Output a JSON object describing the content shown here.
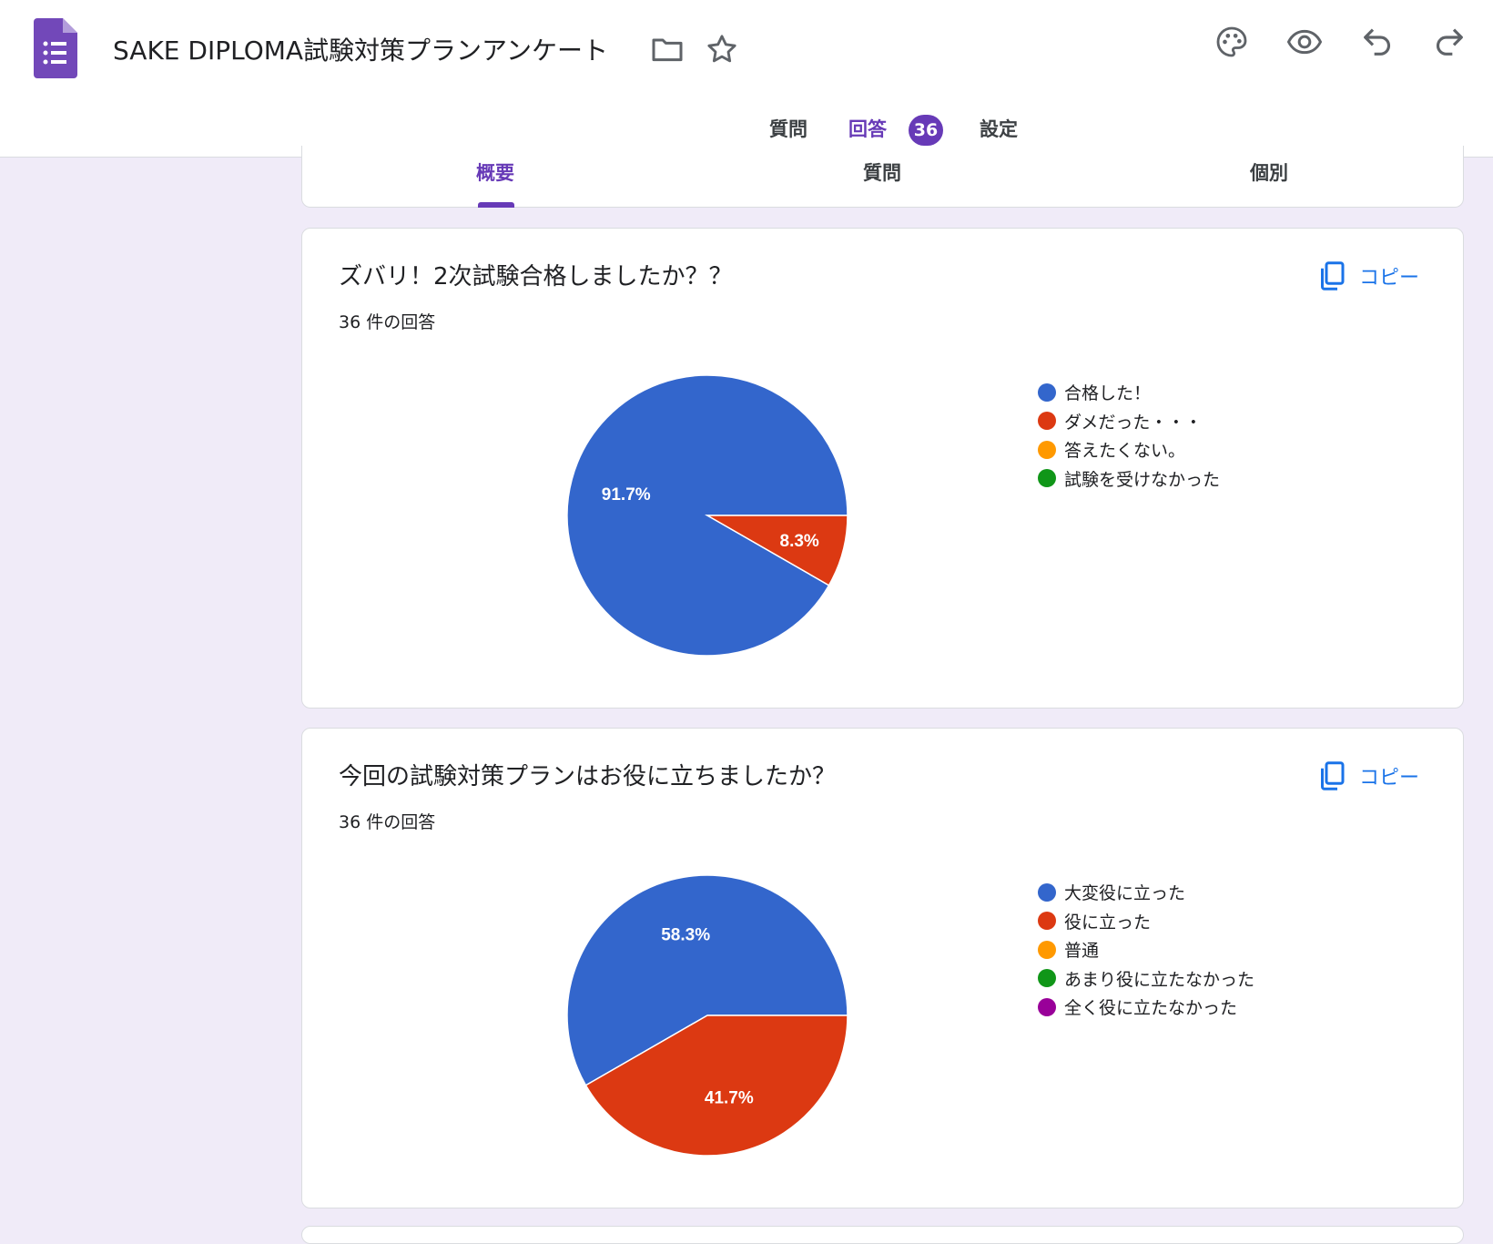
{
  "header": {
    "title": "SAKE DIPLOMA試験対策プランアンケート",
    "app_color": "#7248b9"
  },
  "tabs": [
    {
      "label": "質問",
      "active": false
    },
    {
      "label": "回答",
      "active": true,
      "badge": "36"
    },
    {
      "label": "設定",
      "active": false
    }
  ],
  "sub_tabs": [
    {
      "label": "概要",
      "active": true
    },
    {
      "label": "質問",
      "active": false
    },
    {
      "label": "個別",
      "active": false
    }
  ],
  "copy_label": "コピー",
  "questions": [
    {
      "title": "ズバリ！2次試験合格しましたか？？",
      "count": "36 件の回答",
      "chart_data": {
        "type": "pie",
        "categories": [
          "合格した！",
          "ダメだった・・・",
          "答えたくない。",
          "試験を受けなかった"
        ],
        "values": [
          91.7,
          8.3,
          0,
          0
        ],
        "labels": [
          "91.7%",
          "8.3%",
          "",
          ""
        ],
        "colors": [
          "#3366cc",
          "#dc3912",
          "#ff9900",
          "#109618"
        ],
        "legend": "right"
      }
    },
    {
      "title": "今回の試験対策プランはお役に立ちましたか？",
      "count": "36 件の回答",
      "chart_data": {
        "type": "pie",
        "categories": [
          "大変役に立った",
          "役に立った",
          "普通",
          "あまり役に立たなかった",
          "全く役に立たなかった"
        ],
        "values": [
          58.3,
          41.7,
          0,
          0,
          0
        ],
        "labels": [
          "58.3%",
          "41.7%",
          "",
          "",
          ""
        ],
        "colors": [
          "#3366cc",
          "#dc3912",
          "#ff9900",
          "#109618",
          "#990099"
        ],
        "legend": "right"
      }
    }
  ]
}
